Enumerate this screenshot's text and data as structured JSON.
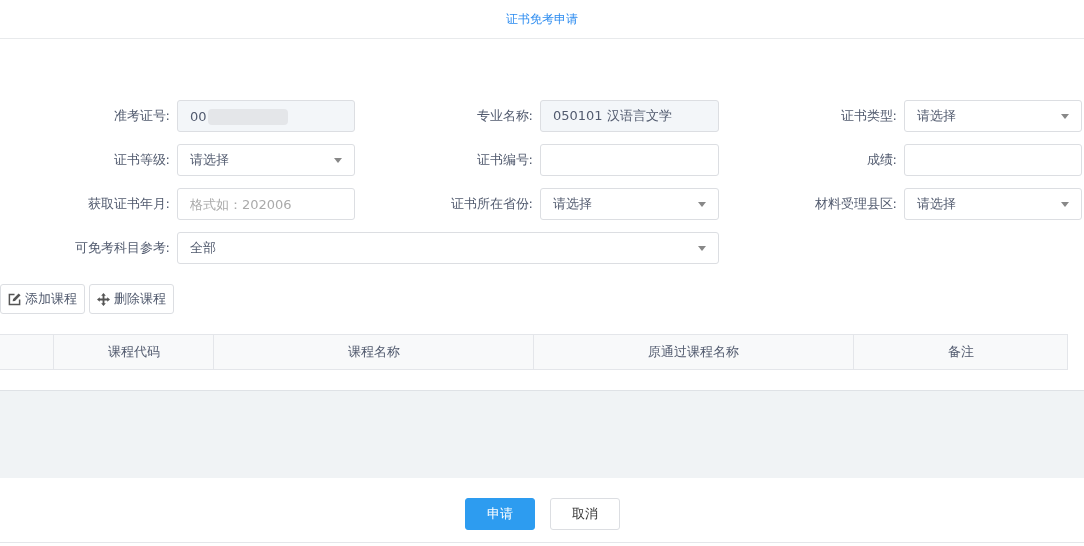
{
  "header": {
    "title": "证书免考申请"
  },
  "form": {
    "rows": [
      [
        {
          "label": "准考证号:",
          "kind": "readonly",
          "value": "00",
          "redacted": true
        },
        {
          "label": "专业名称:",
          "kind": "readonly",
          "value": "050101 汉语言文学"
        },
        {
          "label": "证书类型:",
          "kind": "select",
          "value": "请选择"
        }
      ],
      [
        {
          "label": "证书等级:",
          "kind": "select",
          "value": "请选择"
        },
        {
          "label": "证书编号:",
          "kind": "input"
        },
        {
          "label": "成绩:",
          "kind": "input"
        }
      ],
      [
        {
          "label": "获取证书年月:",
          "kind": "input",
          "placeholder": "格式如：202006"
        },
        {
          "label": "证书所在省份:",
          "kind": "select",
          "value": "请选择"
        },
        {
          "label": "材料受理县区:",
          "kind": "select",
          "value": "请选择"
        }
      ],
      [
        {
          "label": "可免考科目参考:",
          "kind": "select",
          "value": "全部",
          "wide": true
        }
      ]
    ]
  },
  "toolbar": [
    {
      "label": "添加课程",
      "kind": "edit"
    },
    {
      "label": "删除课程",
      "kind": "move"
    }
  ],
  "table": {
    "columns": [
      "课程代码",
      "课程名称",
      "原通过课程名称",
      "备注"
    ]
  },
  "footer": {
    "buttons": [
      {
        "label": "申请",
        "primary": true
      },
      {
        "label": "取消",
        "primary": false
      }
    ]
  }
}
